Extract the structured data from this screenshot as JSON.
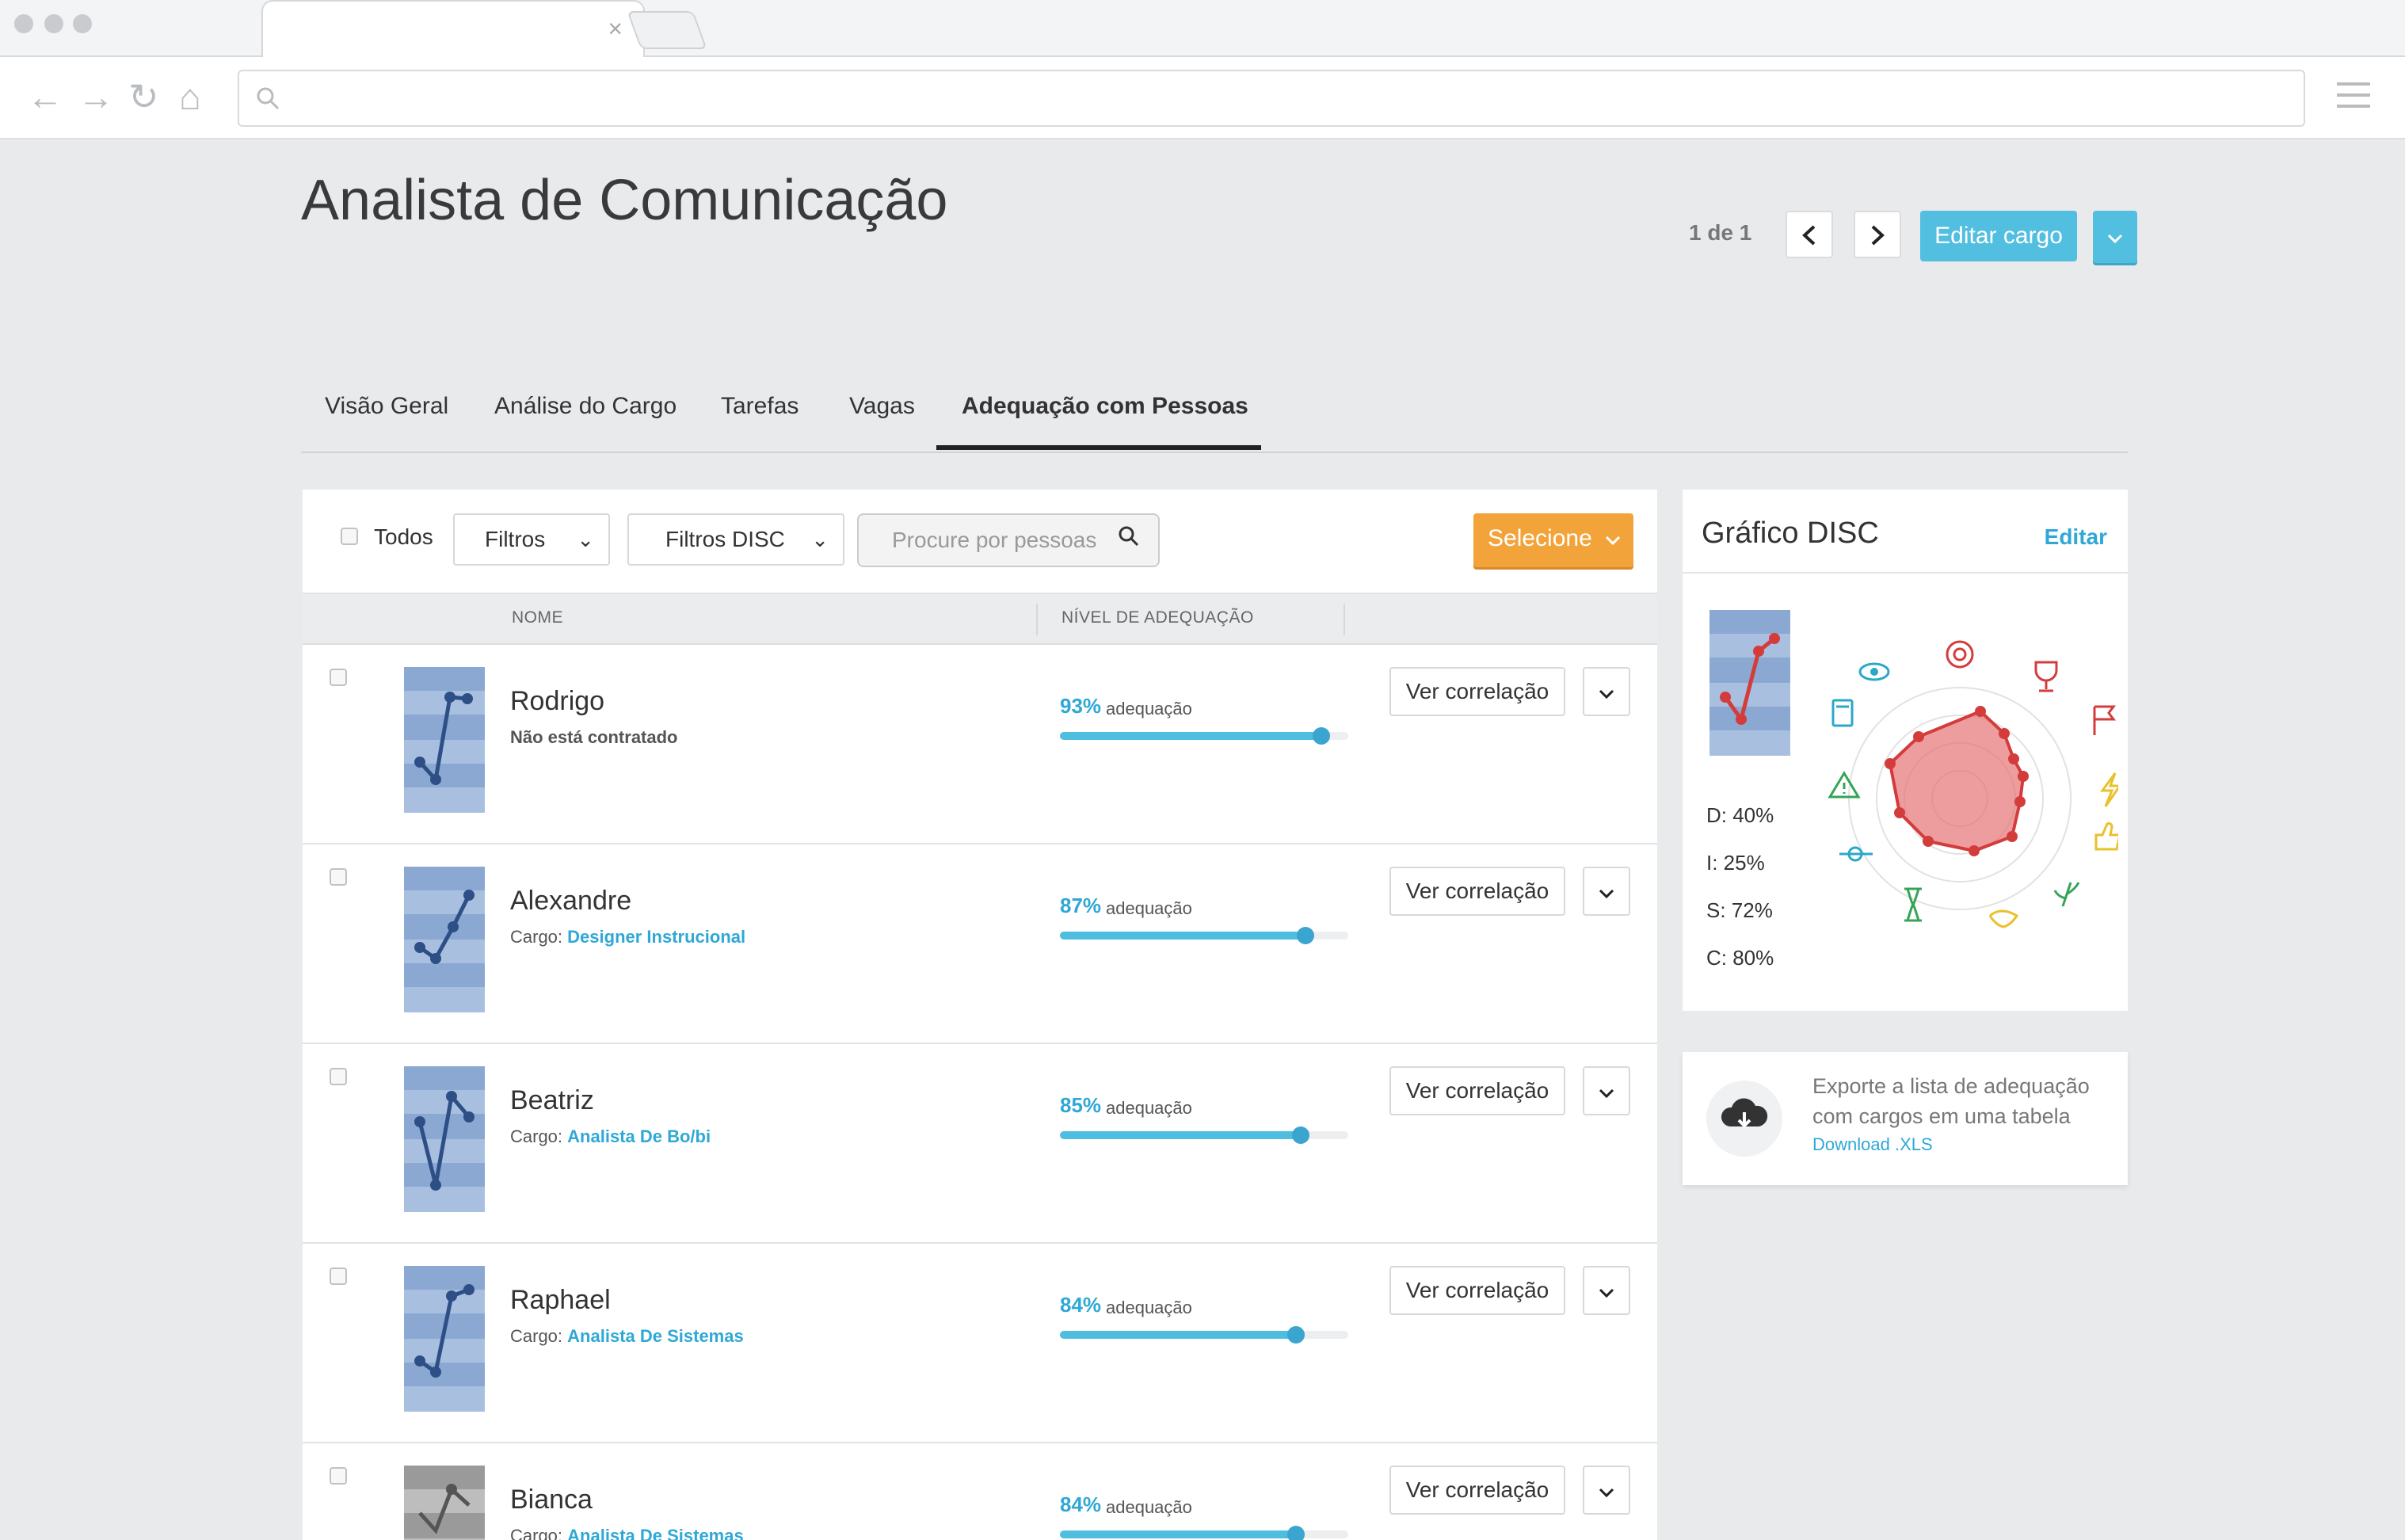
{
  "page": {
    "title": "Analista de Comunicação",
    "pager": "1 de 1",
    "edit_button": "Editar cargo"
  },
  "tabs": [
    {
      "label": "Visão Geral"
    },
    {
      "label": "Análise do Cargo"
    },
    {
      "label": "Tarefas"
    },
    {
      "label": "Vagas"
    },
    {
      "label": "Adequação com Pessoas",
      "active": true
    }
  ],
  "filters": {
    "all_label": "Todos",
    "filters_label": "Filtros",
    "disc_filters_label": "Filtros DISC",
    "search_placeholder": "Procure por pessoas",
    "select_button": "Selecione"
  },
  "table": {
    "col_name": "NOME",
    "col_fit": "NÍVEL DE ADEQUAÇÃO",
    "fit_suffix": "adequação",
    "view_button": "Ver correlação",
    "role_prefix": "Cargo:",
    "rows": [
      {
        "name": "Rodrigo",
        "subtitle": "Não está contratado",
        "role": "",
        "percent": "93%",
        "fit": 0.93
      },
      {
        "name": "Alexandre",
        "subtitle": "",
        "role": "Designer Instrucional",
        "percent": "87%",
        "fit": 0.87
      },
      {
        "name": "Beatriz",
        "subtitle": "",
        "role": "Analista De Bo/bi",
        "percent": "85%",
        "fit": 0.85
      },
      {
        "name": "Raphael",
        "subtitle": "",
        "role": "Analista De Sistemas",
        "percent": "84%",
        "fit": 0.84
      },
      {
        "name": "Bianca",
        "subtitle": "",
        "role": "Analista De Sistemas",
        "percent": "84%",
        "fit": 0.84
      }
    ]
  },
  "disc": {
    "title": "Gráfico DISC",
    "edit": "Editar",
    "d": "D: 40%",
    "i": "I: 25%",
    "s": "S: 72%",
    "c": "C: 80%"
  },
  "export": {
    "text": "Exporte a lista de adequação com cargos em uma tabela",
    "link": "Download .XLS"
  },
  "colors": {
    "accent": "#52bfe0",
    "select_button": "#f2a43a",
    "link": "#2fa8d6",
    "radar_fill": "#e57373"
  },
  "icons": [
    "back-icon",
    "forward-icon",
    "reload-icon",
    "home-icon",
    "search-icon",
    "menu-icon",
    "chevron-down-icon",
    "chevron-left-icon",
    "chevron-right-icon",
    "cloud-download-icon"
  ]
}
